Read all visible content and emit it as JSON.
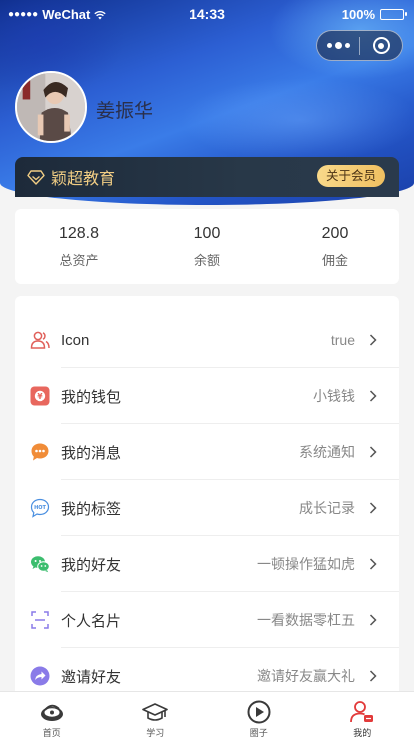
{
  "status_bar": {
    "carrier": "WeChat",
    "time": "14:33",
    "battery": "100%"
  },
  "profile": {
    "name": "姜振华"
  },
  "vip": {
    "brand": "颖超教育",
    "button_label": "关于会员",
    "colors": {
      "gold": "#f1cd84",
      "button": "#f0c061",
      "bar": "#1d2a3a"
    }
  },
  "stats": [
    {
      "value": "128.8",
      "label": "总资产"
    },
    {
      "value": "100",
      "label": "余额"
    },
    {
      "value": "200",
      "label": "佣金"
    }
  ],
  "menu": [
    {
      "icon": "users-icon",
      "label": "Icon",
      "value": "true"
    },
    {
      "icon": "wallet-icon",
      "label": "我的钱包",
      "value": "小钱钱"
    },
    {
      "icon": "chat-bubble-icon",
      "label": "我的消息",
      "value": "系统通知"
    },
    {
      "icon": "hot-tag-icon",
      "label": "我的标签",
      "value": "成长记录"
    },
    {
      "icon": "wechat-icon",
      "label": "我的好友",
      "value": "一顿操作猛如虎"
    },
    {
      "icon": "scan-card-icon",
      "label": "个人名片",
      "value": "一看数据零杠五"
    },
    {
      "icon": "share-arrow-icon",
      "label": "邀请好友",
      "value": "邀请好友赢大礼"
    }
  ],
  "tabs": [
    {
      "icon": "home-icon",
      "label": "首页"
    },
    {
      "icon": "graduation-cap-icon",
      "label": "学习"
    },
    {
      "icon": "play-circle-icon",
      "label": "圈子"
    },
    {
      "icon": "profile-icon",
      "label": "我的",
      "active": true
    }
  ]
}
